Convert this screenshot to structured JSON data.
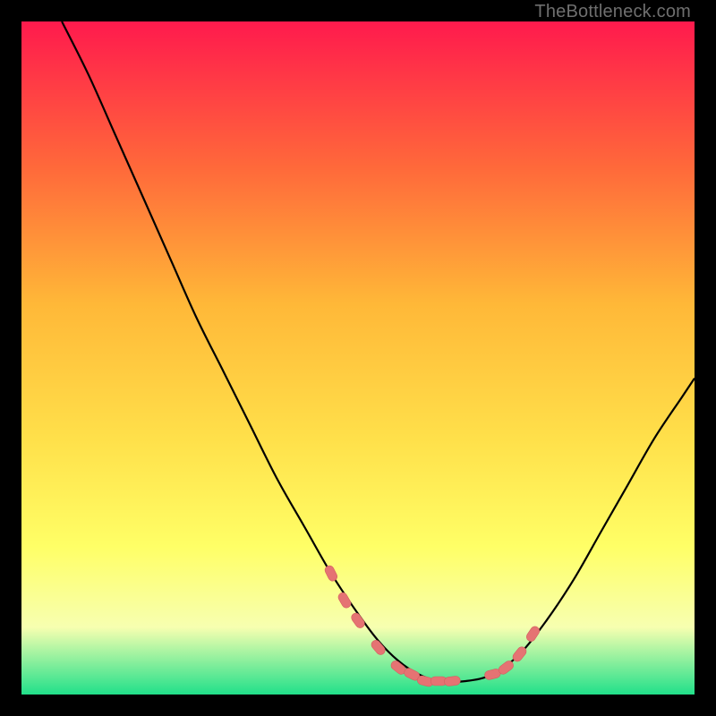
{
  "watermark": "TheBottleneck.com",
  "colors": {
    "gradient_top": "#ff1a4d",
    "gradient_mid1": "#ff6a3a",
    "gradient_mid2": "#ffb838",
    "gradient_mid3": "#ffe04a",
    "gradient_mid4": "#ffff66",
    "gradient_mid5": "#f7ffb0",
    "gradient_bottom": "#21e08a",
    "curve": "#000000",
    "marker_fill": "#e57373",
    "marker_stroke": "#d45f5f"
  },
  "chart_data": {
    "type": "line",
    "title": "",
    "xlabel": "",
    "ylabel": "",
    "xlim": [
      0,
      100
    ],
    "ylim": [
      0,
      100
    ],
    "series": [
      {
        "name": "bottleneck-curve",
        "x": [
          6,
          10,
          14,
          18,
          22,
          26,
          30,
          34,
          38,
          42,
          46,
          50,
          53,
          56,
          59,
          62,
          66,
          70,
          74,
          78,
          82,
          86,
          90,
          94,
          98,
          100
        ],
        "y": [
          100,
          92,
          83,
          74,
          65,
          56,
          48,
          40,
          32,
          25,
          18,
          12,
          8,
          5,
          3,
          2,
          2,
          3,
          6,
          11,
          17,
          24,
          31,
          38,
          44,
          47
        ]
      }
    ],
    "markers": {
      "name": "highlighted-points",
      "x": [
        46,
        48,
        50,
        53,
        56,
        58,
        60,
        62,
        64,
        70,
        72,
        74,
        76
      ],
      "y": [
        18,
        14,
        11,
        7,
        4,
        3,
        2,
        2,
        2,
        3,
        4,
        6,
        9
      ]
    }
  }
}
